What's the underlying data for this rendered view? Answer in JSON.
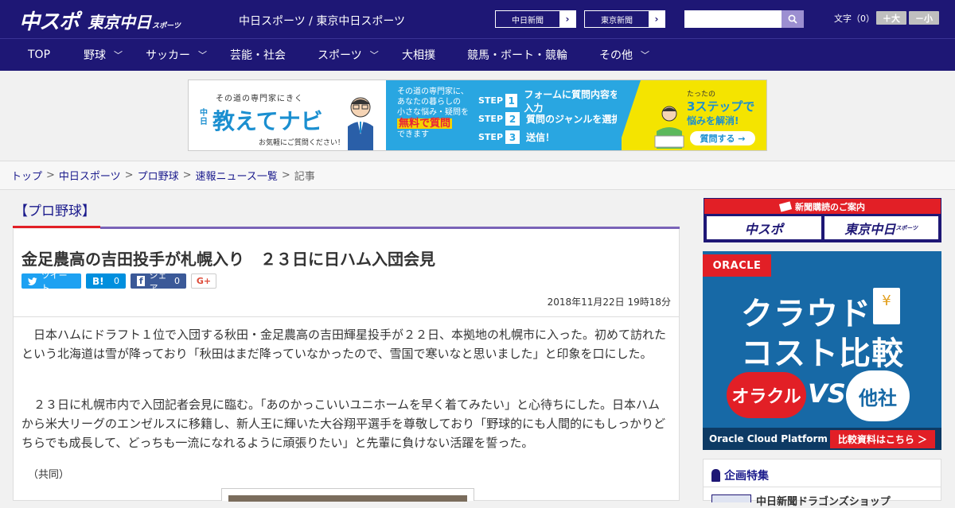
{
  "header": {
    "logo_chuspo": "中スポ",
    "logo_tokyo": "東京中日",
    "logo_tokyo_suffix": "スポーツ",
    "subtitle": "中日スポーツ / 東京中日スポーツ",
    "btn_chunichi": "中日新聞",
    "btn_tokyo": "東京新聞",
    "search_placeholder": "",
    "fontsize_label": "文字（0）",
    "fontsize_up": "＋大",
    "fontsize_down": "－小"
  },
  "nav": {
    "items": [
      {
        "label": "TOP",
        "has_menu": false
      },
      {
        "label": "野球",
        "has_menu": true
      },
      {
        "label": "サッカー",
        "has_menu": true
      },
      {
        "label": "芸能・社会",
        "has_menu": false
      },
      {
        "label": "スポーツ",
        "has_menu": true
      },
      {
        "label": "大相撲",
        "has_menu": false
      },
      {
        "label": "競馬・ボート・競輪",
        "has_menu": false
      },
      {
        "label": "その他",
        "has_menu": true
      }
    ]
  },
  "ad_banner": {
    "tagline": "その道の専門家にきく",
    "brand_prefix": "中日",
    "brand": "教えてナビ",
    "small": "お気軽にご質問ください！",
    "mid_line1": "その道の専門家に、",
    "mid_line2": "あなたの暮らしの",
    "mid_line3": "小さな悩み・疑問を",
    "mid_highlight": "無料で質問",
    "mid_line4": "できます",
    "steps": [
      {
        "label": "STEP",
        "num": "1",
        "text": "フォームに質問内容を入力"
      },
      {
        "label": "STEP",
        "num": "2",
        "text": "質問のジャンルを選択"
      },
      {
        "label": "STEP",
        "num": "3",
        "text": "送信！"
      }
    ],
    "right_small": "たったの",
    "right_big": "3ステップで",
    "right_sub": "悩みを解消!",
    "right_btn": "質問する →"
  },
  "breadcrumb": {
    "items": [
      "トップ",
      "中日スポーツ",
      "プロ野球",
      "速報ニュース一覧"
    ],
    "current": "記事",
    "sep": ">"
  },
  "article": {
    "category": "【プロ野球】",
    "title": "金足農高の吉田投手が札幌入り　２３日に日ハム入団会見",
    "share": {
      "tweet": "ツイート",
      "hatena": "B!",
      "hatena_count": "0",
      "facebook": "シェア",
      "facebook_count": "0",
      "gplus": "G+"
    },
    "date": "2018年11月22日 19時18分",
    "paragraphs": [
      "　日本ハムにドラフト１位で入団する秋田・金足農高の吉田輝星投手が２２日、本拠地の札幌市に入った。初めて訪れたという北海道は雪が降っており「秋田はまだ降っていなかったので、雪国で寒いなと思いました」と印象を口にした。",
      "　２３日に札幌市内で入団記者会見に臨む。「あのかっこいいユニホームを早く着てみたい」と心待ちにした。日本ハムから米大リーグのエンゼルスに移籍し、新人王に輝いた大谷翔平選手を尊敬しており「野球的にも人間的にもしっかりどちらでも成長して、どっちも一流になれるように頑張りたい」と先輩に負けない活躍を誓った。"
    ],
    "credit": "（共同）"
  },
  "sidebar": {
    "subscribe_head": "新聞購読のご案内",
    "subscribe_logo1": "中スポ",
    "subscribe_logo2": "東京中日",
    "subscribe_logo2_suffix": "スポーツ",
    "oracle": {
      "logo": "ORACLE",
      "h1": "クラウド",
      "h2": "コスト比較",
      "left_cloud": "オラクル",
      "vs": "VS",
      "right_cloud": "他社",
      "doc_symbol": "¥",
      "foot_left": "Oracle Cloud Platform",
      "foot_right": "比較資料はこちら ＞"
    },
    "feature_head": "企画特集",
    "feature_item": "中日新聞ドラゴンズショップ"
  },
  "colors": {
    "brand_navy": "#1e1775",
    "accent_red": "#e21f26",
    "accent_purple": "#7a63b8",
    "twitter": "#1da1f2",
    "hatena": "#008fde",
    "facebook": "#3b5998"
  }
}
